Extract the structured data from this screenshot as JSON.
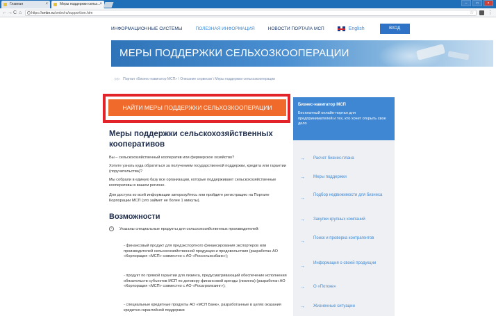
{
  "browser": {
    "tabs": [
      {
        "label": "Главная"
      },
      {
        "label": "Меры поддержки сельх..."
      }
    ],
    "url_prefix": "https://",
    "url_host": "smbn.ru",
    "url_path": "/smbn/ru/support/sm.htm"
  },
  "nav": {
    "items": [
      {
        "label": "ИНФОРМАЦИОННЫЕ СИСТЕМЫ",
        "active": false
      },
      {
        "label": "ПОЛЕЗНАЯ ИНФОРМАЦИЯ",
        "active": true
      },
      {
        "label": "НОВОСТИ ПОРТАЛА МСП",
        "active": false
      }
    ],
    "language": "English",
    "login": "ВХОД"
  },
  "banner": {
    "title": "МЕРЫ ПОДДЕРЖКИ СЕЛЬХОЗКООПЕРАЦИИ"
  },
  "breadcrumb": "Портал «Бизнес-навигатор МСП» \\ Описание сервисов \\ Меры поддержки сельхозкооперации",
  "cta": {
    "label": "НАЙТИ МЕРЫ ПОДДЕРЖКИ СЕЛЬХОЗКООПЕРАЦИИ"
  },
  "main": {
    "heading": "Меры поддержки сельскохозяйственных кооперативов",
    "paragraphs": [
      "Вы – сельскохозяйственный кооператив или фермерское хозяйство?",
      "Хотите узнать куда обратиться за получением государственной поддержки, кредита или гарантии (поручительства)?",
      "Мы собрали в единую базу все организации, которые поддерживают сельскохозяйственные кооперативы в вашем регионе.",
      "Для доступа ко всей информации авторизуйтесь или пройдите регистрацию на Портале Корпорации МСП (это займет не более 1 минуты)."
    ],
    "subheading": "Возможности",
    "features_intro": "Указаны специальные продукты для сельскохозяйственных производителей:",
    "features": [
      "- финансовый продукт для предэкспортного финансирования экспортеров или производителей сельскохозяйственной продукции и продовольствия (разработан АО «Корпорация «МСП» совместно с АО «Россельхозбанк»);",
      "- продукт по прямой гарантии для лизинга, предусматривающий обеспечение исполнения обязательств субъектов МСП по договору финансовой аренды (лизинга) (разработан АО «Корпорация «МСП» совместно с АО «Росагролизинг»);",
      "- специальные кредитные продукты АО «МСП Банк», разработанные в целях оказания кредитно-гарантийной поддержки"
    ]
  },
  "sidebar": {
    "promo_title": "Бизнес-навигатор МСП",
    "promo_text": "Бесплатный онлайн-портал для предпринимателей и тех, кто хочет открыть свое дело",
    "items": [
      {
        "label": "Расчет бизнес-плана"
      },
      {
        "label": "Меры поддержки"
      },
      {
        "label": "Подбор недвижимости для бизнеса"
      },
      {
        "label": "Закупки крупных компаний"
      },
      {
        "label": "Поиск и проверка контрагентов"
      },
      {
        "label": "Информация о своей продукции"
      },
      {
        "label": "О «Потоке»"
      },
      {
        "label": "Жизненные ситуации"
      }
    ]
  },
  "colors": {
    "brand_blue": "#2f73c6",
    "cta_orange": "#ef6a2b",
    "highlight_red": "#e2242a",
    "link_blue": "#3f8ad6"
  }
}
